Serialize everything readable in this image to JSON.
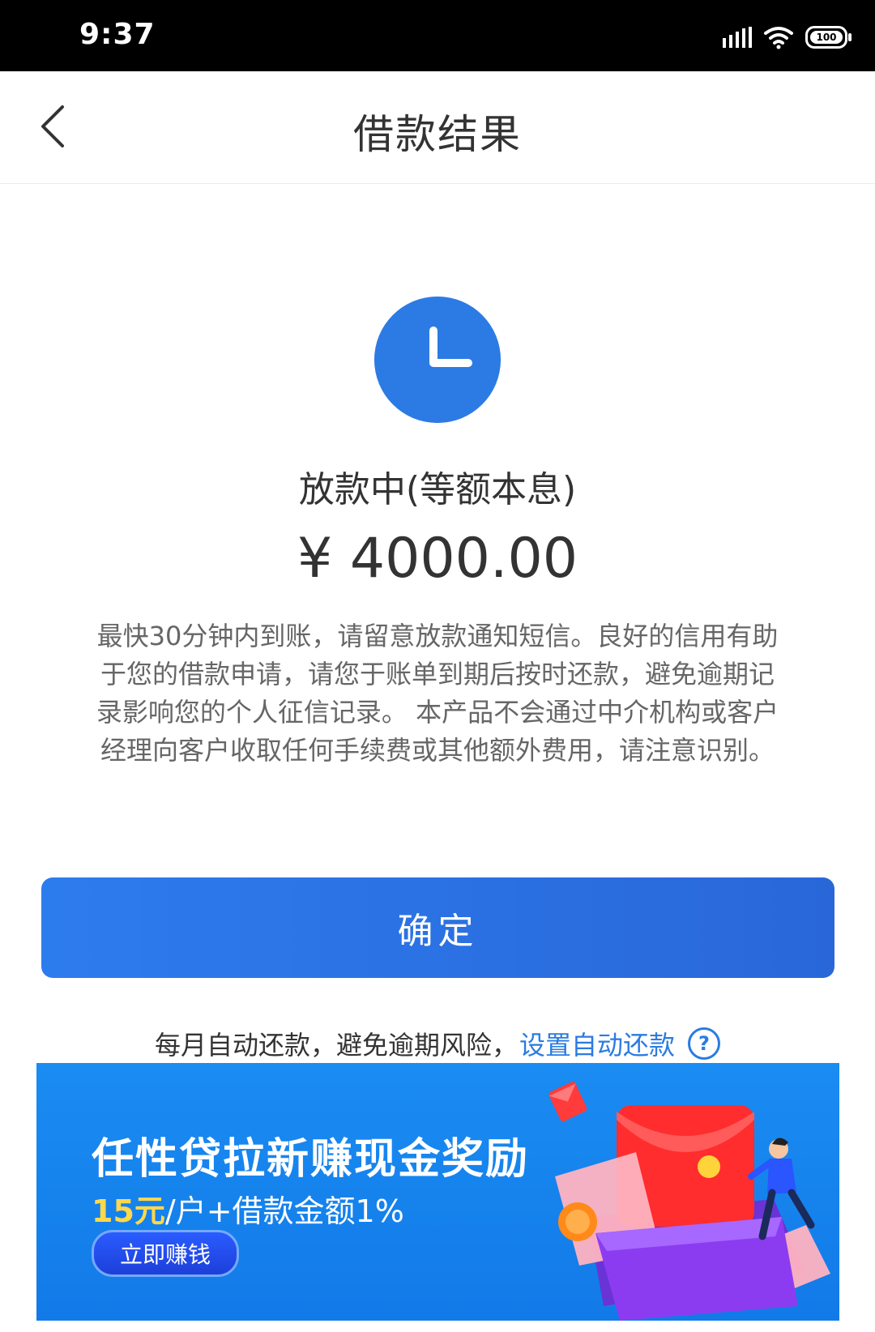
{
  "status_bar": {
    "time": "9:37",
    "battery": "100"
  },
  "header": {
    "title": "借款结果"
  },
  "result": {
    "status": "放款中(等额本息)",
    "amount": "¥ 4000.00",
    "notice": "最快30分钟内到账，请留意放款通知短信。良好的信用有助于您的借款申请，请您于账单到期后按时还款，避免逾期记录影响您的个人征信记录。 本产品不会通过中介机构或客户经理向客户收取任何手续费或其他额外费用，请注意识别。"
  },
  "confirm_button": {
    "label": "确定"
  },
  "autorepay": {
    "tip": "每月自动还款，避免逾期风险，",
    "link": "设置自动还款"
  },
  "promo": {
    "title": "任性贷拉新赚现金奖励",
    "reward": "15元",
    "subtitle_rest": "/户+借款金额1%",
    "button": "立即赚钱"
  },
  "colors": {
    "primary": "#2c7be5",
    "link": "#2a7be2",
    "banner": "#1a8cf2",
    "reward": "#ffd84a"
  }
}
